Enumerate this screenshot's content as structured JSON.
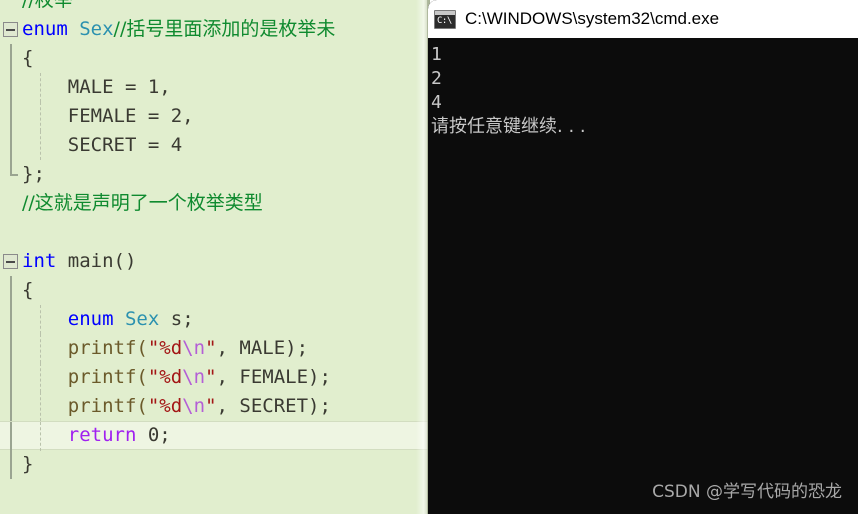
{
  "editor": {
    "name": "code-editor",
    "background_color": "#e1eece",
    "lines": [
      {
        "id": "l1",
        "fold": "none",
        "clipped_top": true,
        "tokens": [
          {
            "t": "comment",
            "v": "//枚举"
          }
        ]
      },
      {
        "id": "l2",
        "fold": "box",
        "tokens": [
          {
            "t": "keyword",
            "v": "enum"
          },
          {
            "t": "plain",
            "v": " "
          },
          {
            "t": "type",
            "v": "Sex"
          },
          {
            "t": "comment",
            "v": "//括号里面添加的是枚举未"
          }
        ]
      },
      {
        "id": "l3",
        "fold": "line",
        "tokens": [
          {
            "t": "plain",
            "v": "{"
          }
        ]
      },
      {
        "id": "l4",
        "fold": "line",
        "indent": true,
        "tokens": [
          {
            "t": "plain",
            "v": "    MALE = 1,"
          }
        ]
      },
      {
        "id": "l5",
        "fold": "line",
        "indent": true,
        "tokens": [
          {
            "t": "plain",
            "v": "    FEMALE = 2,"
          }
        ]
      },
      {
        "id": "l6",
        "fold": "line",
        "indent": true,
        "tokens": [
          {
            "t": "plain",
            "v": "    SECRET = 4"
          }
        ]
      },
      {
        "id": "l7",
        "fold": "endline",
        "tokens": [
          {
            "t": "plain",
            "v": "};"
          }
        ]
      },
      {
        "id": "l8",
        "fold": "none",
        "tokens": [
          {
            "t": "comment",
            "v": "//这就是声明了一个枚举类型"
          }
        ]
      },
      {
        "id": "l9",
        "fold": "none",
        "tokens": [
          {
            "t": "plain",
            "v": ""
          }
        ]
      },
      {
        "id": "l10",
        "fold": "box",
        "tokens": [
          {
            "t": "keyword",
            "v": "int"
          },
          {
            "t": "plain",
            "v": " main()"
          }
        ]
      },
      {
        "id": "l11",
        "fold": "line",
        "tokens": [
          {
            "t": "plain",
            "v": "{"
          }
        ]
      },
      {
        "id": "l12",
        "fold": "line",
        "indent": true,
        "tokens": [
          {
            "t": "plain",
            "v": "    "
          },
          {
            "t": "keyword",
            "v": "enum"
          },
          {
            "t": "plain",
            "v": " "
          },
          {
            "t": "type",
            "v": "Sex"
          },
          {
            "t": "plain",
            "v": " s;"
          }
        ]
      },
      {
        "id": "l13",
        "fold": "line",
        "indent": true,
        "tokens": [
          {
            "t": "func",
            "v": "    printf("
          },
          {
            "t": "string",
            "v": "\"%d"
          },
          {
            "t": "escape",
            "v": "\\n"
          },
          {
            "t": "string",
            "v": "\""
          },
          {
            "t": "plain",
            "v": ", MALE);"
          }
        ]
      },
      {
        "id": "l14",
        "fold": "line",
        "indent": true,
        "tokens": [
          {
            "t": "func",
            "v": "    printf("
          },
          {
            "t": "string",
            "v": "\"%d"
          },
          {
            "t": "escape",
            "v": "\\n"
          },
          {
            "t": "string",
            "v": "\""
          },
          {
            "t": "plain",
            "v": ", FEMALE);"
          }
        ]
      },
      {
        "id": "l15",
        "fold": "line",
        "indent": true,
        "tokens": [
          {
            "t": "func",
            "v": "    printf("
          },
          {
            "t": "string",
            "v": "\"%d"
          },
          {
            "t": "escape",
            "v": "\\n"
          },
          {
            "t": "string",
            "v": "\""
          },
          {
            "t": "plain",
            "v": ", SECRET);"
          }
        ]
      },
      {
        "id": "l16",
        "fold": "line",
        "indent": true,
        "current": true,
        "tokens": [
          {
            "t": "plain",
            "v": "    "
          },
          {
            "t": "ctrl",
            "v": "return"
          },
          {
            "t": "plain",
            "v": " 0;"
          }
        ]
      },
      {
        "id": "l17",
        "fold": "line",
        "tokens": [
          {
            "t": "plain",
            "v": "}"
          }
        ]
      }
    ]
  },
  "console": {
    "name": "cmd-window",
    "title": "C:\\WINDOWS\\system32\\cmd.exe",
    "icon": "cmd-prompt-icon",
    "icon_glyph": "C:\\",
    "background_color": "#0c0c0c",
    "text_color": "#c8c8c8",
    "output_lines": [
      "1",
      "2",
      "4",
      "请按任意键继续. . ."
    ],
    "watermark": "CSDN @学写代码的恐龙"
  }
}
